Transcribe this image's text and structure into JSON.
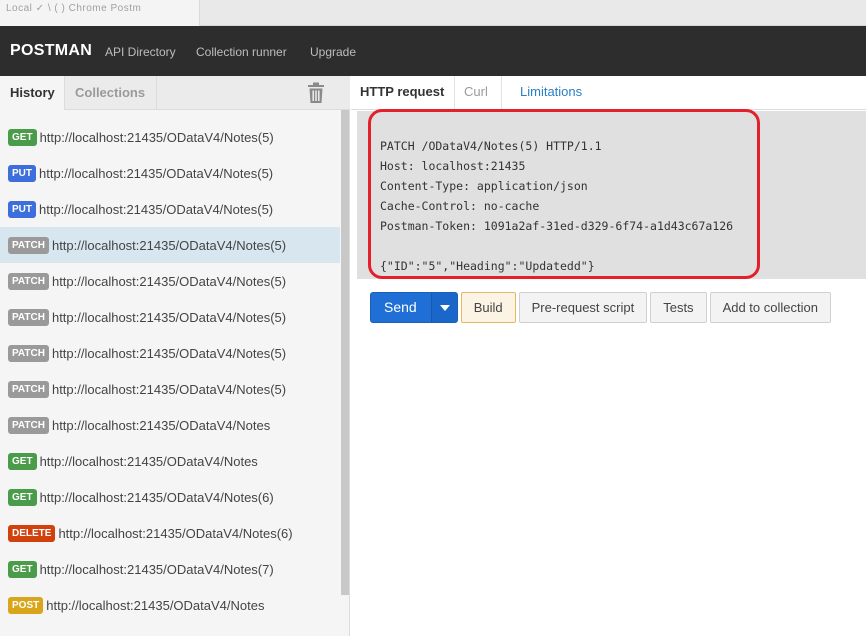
{
  "chrome": {
    "tab_text": "Local ✓ \\ (    )   Chrome   Postm"
  },
  "header": {
    "logo": "POSTMAN",
    "nav": [
      "API Directory",
      "Collection runner",
      "Upgrade"
    ]
  },
  "sidebar": {
    "tabs": [
      "History",
      "Collections"
    ],
    "trash_icon": "trash-icon",
    "history": [
      {
        "method": "GET",
        "url": "http://localhost:21435/ODataV4/Notes(5)"
      },
      {
        "method": "PUT",
        "url": "http://localhost:21435/ODataV4/Notes(5)"
      },
      {
        "method": "PUT",
        "url": "http://localhost:21435/ODataV4/Notes(5)"
      },
      {
        "method": "PATCH",
        "url": "http://localhost:21435/ODataV4/Notes(5)"
      },
      {
        "method": "PATCH",
        "url": "http://localhost:21435/ODataV4/Notes(5)"
      },
      {
        "method": "PATCH",
        "url": "http://localhost:21435/ODataV4/Notes(5)"
      },
      {
        "method": "PATCH",
        "url": "http://localhost:21435/ODataV4/Notes(5)"
      },
      {
        "method": "PATCH",
        "url": "http://localhost:21435/ODataV4/Notes(5)"
      },
      {
        "method": "PATCH",
        "url": "http://localhost:21435/ODataV4/Notes"
      },
      {
        "method": "GET",
        "url": "http://localhost:21435/ODataV4/Notes"
      },
      {
        "method": "GET",
        "url": "http://localhost:21435/ODataV4/Notes(6)"
      },
      {
        "method": "DELETE",
        "url": "http://localhost:21435/ODataV4/Notes(6)"
      },
      {
        "method": "GET",
        "url": "http://localhost:21435/ODataV4/Notes(7)"
      },
      {
        "method": "POST",
        "url": "http://localhost:21435/ODataV4/Notes"
      }
    ]
  },
  "main": {
    "tabs": [
      "HTTP request",
      "Curl",
      "Limitations"
    ],
    "request_text": "PATCH /ODataV4/Notes(5) HTTP/1.1\nHost: localhost:21435\nContent-Type: application/json\nCache-Control: no-cache\nPostman-Token: 1091a2af-31ed-d329-6f74-a1d43c67a126\n\n{\"ID\":\"5\",\"Heading\":\"Updatedd\"}",
    "send_label": "Send",
    "buttons": [
      "Build",
      "Pre-request script",
      "Tests",
      "Add to collection"
    ]
  },
  "colors": {
    "highlight": "#e3202b",
    "send": "#1f6fd6",
    "header": "#2d2d2d",
    "selected_row": "#d7e6ef"
  }
}
